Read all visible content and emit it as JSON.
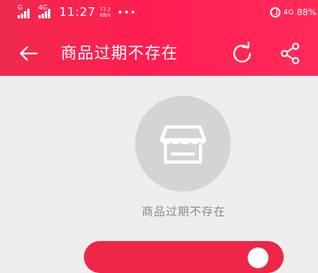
{
  "status_bar": {
    "signal1_label": "G",
    "signal2_label": "4G",
    "time": "11:27",
    "speed_value": "77.3",
    "speed_unit": "KB/s",
    "dots": "•••",
    "network": "4G",
    "battery": "88%"
  },
  "header": {
    "title": "商品过期不存在"
  },
  "empty_state": {
    "message": "商品过期不存在"
  },
  "colors": {
    "header": "#ff1e52",
    "background": "#eeeeee",
    "icon_circle": "#d4d4d4",
    "button": "#ee2648"
  },
  "icons": {
    "back": "back-arrow-icon",
    "refresh": "refresh-icon",
    "share": "share-icon",
    "store": "store-icon"
  }
}
